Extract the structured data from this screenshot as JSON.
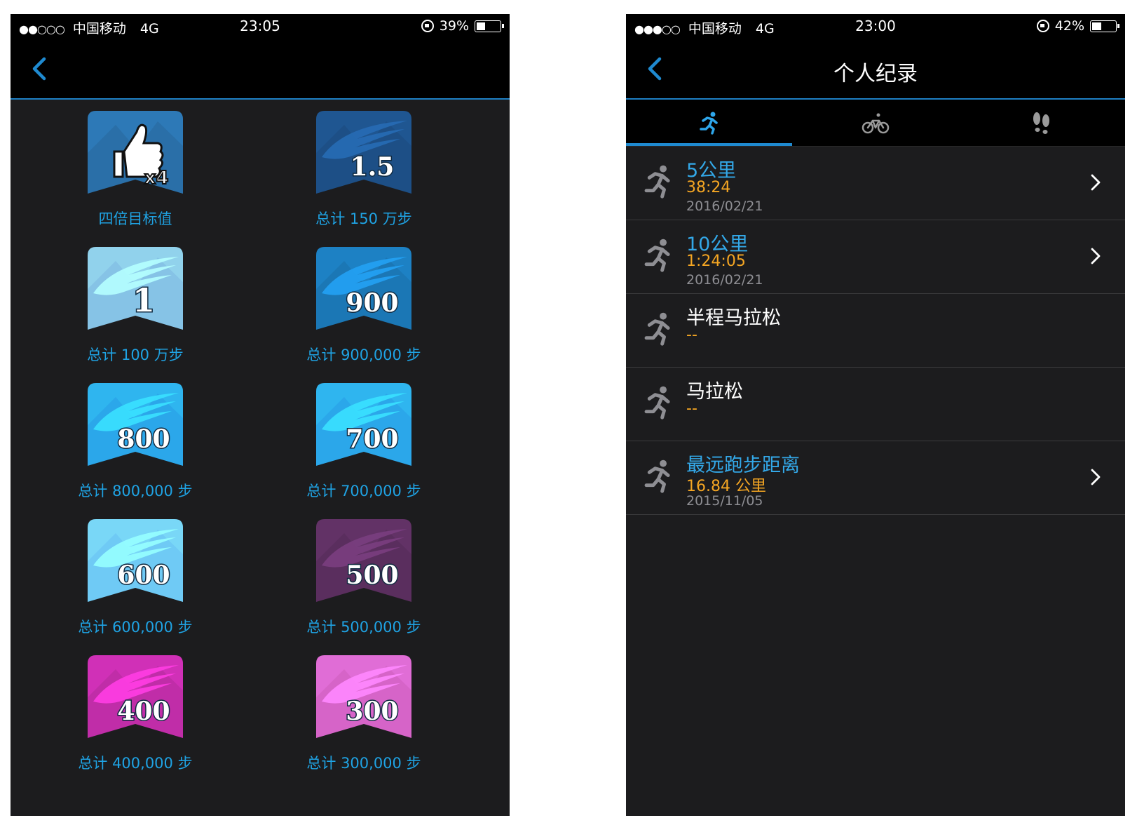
{
  "left_screen": {
    "status": {
      "carrier": "中国移动",
      "network": "4G",
      "time": "23:05",
      "battery": "39%",
      "battery_level": 0.39,
      "signal_dots": "●●○○○"
    },
    "badges": [
      {
        "label": "四倍目标值",
        "number": "x4",
        "color": "#2a6fa8",
        "icon": "thumbs-up"
      },
      {
        "label": "总计 150 万步",
        "number": "1.5",
        "color": "#1d4f86",
        "icon": "wing"
      },
      {
        "label": "总计 100 万步",
        "number": "1",
        "color": "#86c3e6",
        "icon": "wing"
      },
      {
        "label": "总计 900,000 步",
        "number": "900",
        "color": "#1b77b5",
        "icon": "wing"
      },
      {
        "label": "总计 800,000 步",
        "number": "800",
        "color": "#2ba7ea",
        "icon": "wing"
      },
      {
        "label": "总计 700,000 步",
        "number": "700",
        "color": "#2ba7ea",
        "icon": "wing"
      },
      {
        "label": "总计 600,000 步",
        "number": "600",
        "color": "#6fcaf5",
        "icon": "wing"
      },
      {
        "label": "总计 500,000 步",
        "number": "500",
        "color": "#5a2e5e",
        "icon": "wing"
      },
      {
        "label": "总计 400,000 步",
        "number": "400",
        "color": "#c02da8",
        "icon": "wing"
      },
      {
        "label": "总计 300,000 步",
        "number": "300",
        "color": "#d664c8",
        "icon": "wing"
      }
    ]
  },
  "right_screen": {
    "status": {
      "carrier": "中国移动",
      "network": "4G",
      "time": "23:00",
      "battery": "42%",
      "battery_level": 0.42,
      "signal_dots": "●●●○○"
    },
    "title": "个人纪录",
    "tabs": [
      {
        "icon": "running-icon",
        "active": true
      },
      {
        "icon": "bicycle-icon",
        "active": false
      },
      {
        "icon": "footprints-icon",
        "active": false
      }
    ],
    "records": [
      {
        "name": "5公里",
        "value": "38:24",
        "date": "2016/02/21",
        "has_record": true
      },
      {
        "name": "10公里",
        "value": "1:24:05",
        "date": "2016/02/21",
        "has_record": true
      },
      {
        "name": "半程马拉松",
        "value": "--",
        "date": "",
        "has_record": false
      },
      {
        "name": "马拉松",
        "value": "--",
        "date": "",
        "has_record": false
      },
      {
        "name": "最远跑步距离",
        "value": "16.84 公里",
        "date": "2015/11/05",
        "has_record": true
      }
    ]
  }
}
